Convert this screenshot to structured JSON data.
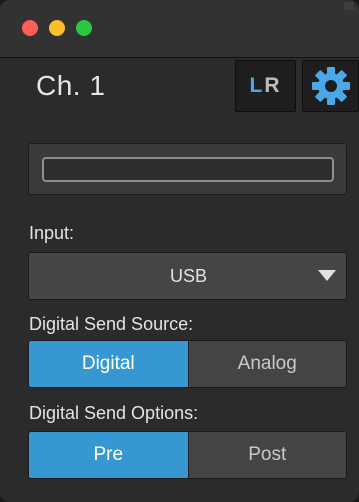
{
  "window": {
    "controls": [
      "close",
      "minimize",
      "zoom"
    ]
  },
  "channel": {
    "title": "Ch. 1",
    "lr_button": {
      "left": "L",
      "right": "R"
    },
    "settings_icon": "gear-icon",
    "name_value": ""
  },
  "input": {
    "label": "Input:",
    "selected": "USB"
  },
  "digital_send_source": {
    "label": "Digital Send Source:",
    "options": [
      "Digital",
      "Analog"
    ],
    "selected": "Digital"
  },
  "digital_send_options": {
    "label": "Digital Send Options:",
    "options": [
      "Pre",
      "Post"
    ],
    "selected": "Pre"
  },
  "colors": {
    "accent": "#3797d2",
    "lr_active": "#4aa8e8",
    "background": "#2b2b2b"
  }
}
